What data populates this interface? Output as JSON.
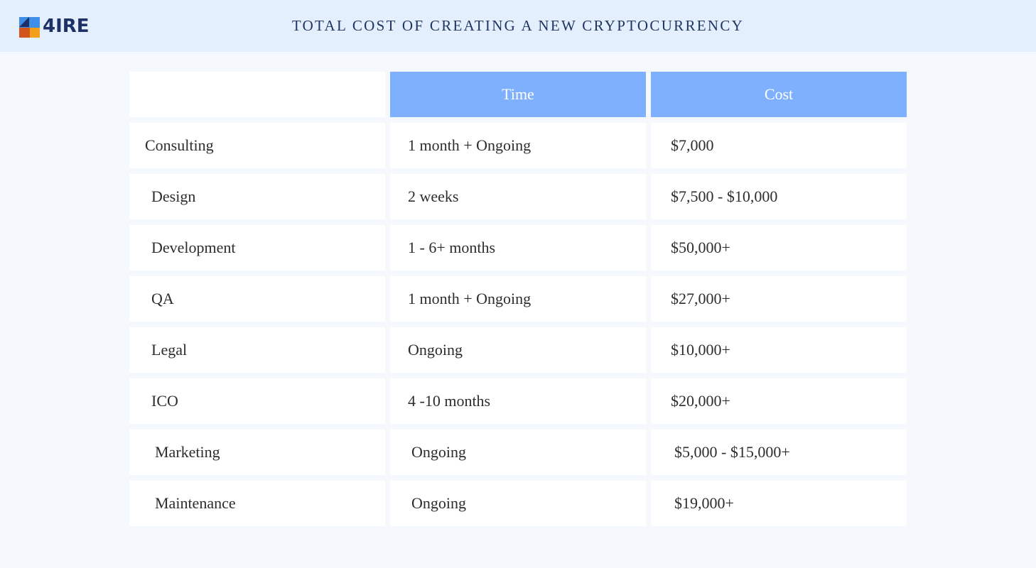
{
  "header": {
    "logo_text": "4IRE",
    "title": "TOTAL COST OF CREATING A NEW CRYPTOCURRENCY"
  },
  "table": {
    "columns": [
      "",
      "Time",
      "Cost"
    ],
    "rows": [
      {
        "stage": "Consulting",
        "time": "1 month + Ongoing",
        "cost": "$7,000"
      },
      {
        "stage": "Design",
        "time": "2 weeks",
        "cost": "$7,500 - $10,000"
      },
      {
        "stage": "Development",
        "time": "1 - 6+ months",
        "cost": "$50,000+"
      },
      {
        "stage": "QA",
        "time": "1 month + Ongoing",
        "cost": "$27,000+"
      },
      {
        "stage": "Legal",
        "time": "Ongoing",
        "cost": "$10,000+"
      },
      {
        "stage": "ICO",
        "time": "4 -10 months",
        "cost": "$20,000+"
      },
      {
        "stage": "Marketing",
        "time": "Ongoing",
        "cost": "$5,000 - $15,000+"
      },
      {
        "stage": "Maintenance",
        "time": "Ongoing",
        "cost": "$19,000+"
      }
    ]
  },
  "colors": {
    "header_bg": "#e4effd",
    "column_header_bg": "#7eb0fe",
    "title_color": "#1f3463"
  }
}
